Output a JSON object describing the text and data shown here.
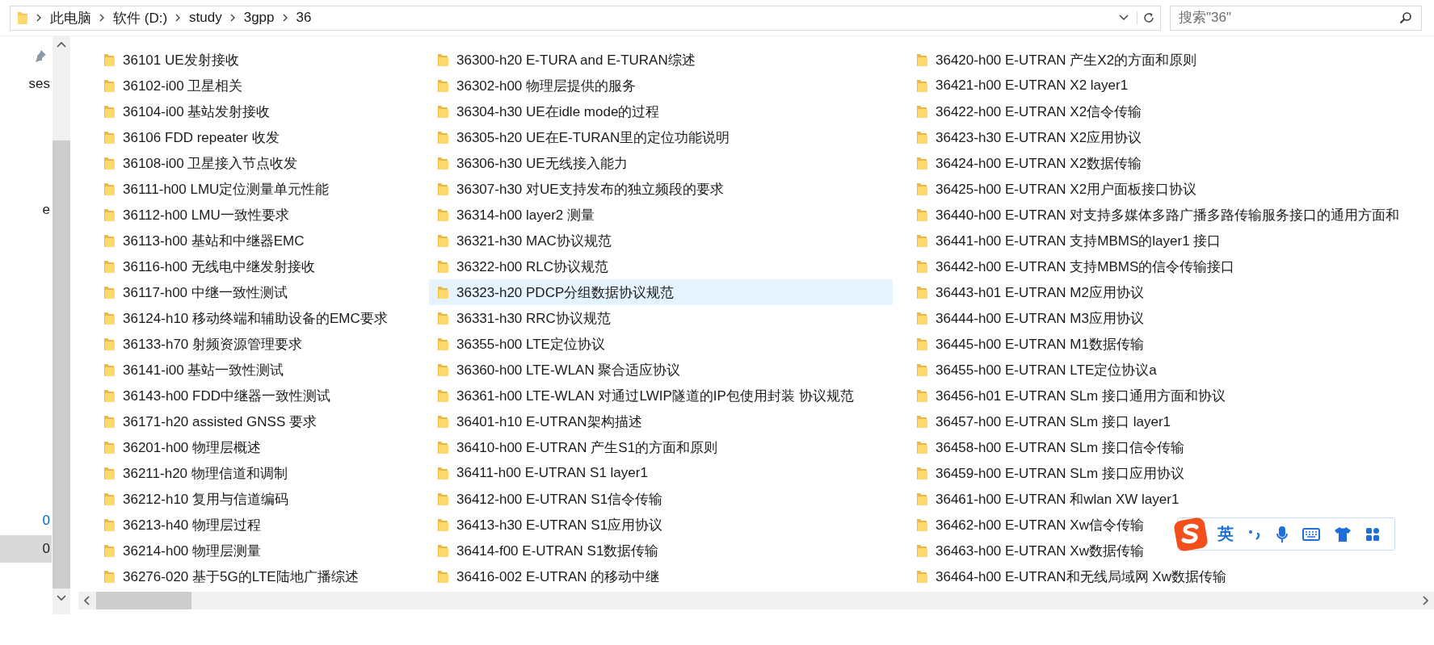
{
  "address_bar": {
    "path": [
      "此电脑",
      "软件 (D:)",
      "study",
      "3gpp",
      "36"
    ]
  },
  "search": {
    "placeholder": "搜索\"36\""
  },
  "nav_pane": {
    "items": [
      {
        "label": "ses",
        "selected": false,
        "kind": "plain"
      },
      {
        "label": "e",
        "selected": false,
        "kind": "plain"
      },
      {
        "label": "0",
        "selected": false,
        "kind": "link"
      },
      {
        "label": "0",
        "selected": true,
        "kind": "plain"
      }
    ]
  },
  "files": {
    "items": [
      {
        "name": "36101 UE发射接收",
        "selected": false
      },
      {
        "name": "36102-i00 卫星相关",
        "selected": false
      },
      {
        "name": "36104-i00 基站发射接收",
        "selected": false
      },
      {
        "name": "36106 FDD repeater 收发",
        "selected": false
      },
      {
        "name": "36108-i00 卫星接入节点收发",
        "selected": false
      },
      {
        "name": "36111-h00 LMU定位测量单元性能",
        "selected": false
      },
      {
        "name": "36112-h00 LMU一致性要求",
        "selected": false
      },
      {
        "name": "36113-h00 基站和中继器EMC",
        "selected": false
      },
      {
        "name": "36116-h00 无线电中继发射接收",
        "selected": false
      },
      {
        "name": "36117-h00 中继一致性测试",
        "selected": false
      },
      {
        "name": "36124-h10 移动终端和辅助设备的EMC要求",
        "selected": false
      },
      {
        "name": "36133-h70 射频资源管理要求",
        "selected": false
      },
      {
        "name": "36141-i00 基站一致性测试",
        "selected": false
      },
      {
        "name": "36143-h00 FDD中继器一致性测试",
        "selected": false
      },
      {
        "name": "36171-h20 assisted GNSS 要求",
        "selected": false
      },
      {
        "name": "36201-h00 物理层概述",
        "selected": false
      },
      {
        "name": "36211-h20 物理信道和调制",
        "selected": false
      },
      {
        "name": "36212-h10 复用与信道编码",
        "selected": false
      },
      {
        "name": "36213-h40 物理层过程",
        "selected": false
      },
      {
        "name": "36214-h00 物理层测量",
        "selected": false
      },
      {
        "name": "36276-020 基于5G的LTE陆地广播综述",
        "selected": false
      },
      {
        "name": "36300-h20 E-TURA and E-TURAN综述",
        "selected": false
      },
      {
        "name": "36302-h00 物理层提供的服务",
        "selected": false
      },
      {
        "name": "36304-h30 UE在idle mode的过程",
        "selected": false
      },
      {
        "name": "36305-h20 UE在E-TURAN里的定位功能说明",
        "selected": false
      },
      {
        "name": "36306-h30 UE无线接入能力",
        "selected": false
      },
      {
        "name": "36307-h30 对UE支持发布的独立频段的要求",
        "selected": false
      },
      {
        "name": "36314-h00 layer2 测量",
        "selected": false
      },
      {
        "name": "36321-h30 MAC协议规范",
        "selected": false
      },
      {
        "name": "36322-h00 RLC协议规范",
        "selected": false
      },
      {
        "name": "36323-h20 PDCP分组数据协议规范",
        "selected": true
      },
      {
        "name": "36331-h30 RRC协议规范",
        "selected": false
      },
      {
        "name": "36355-h00 LTE定位协议",
        "selected": false
      },
      {
        "name": "36360-h00 LTE-WLAN 聚合适应协议",
        "selected": false
      },
      {
        "name": "36361-h00 LTE-WLAN 对通过LWIP隧道的IP包使用封装 协议规范",
        "selected": false
      },
      {
        "name": "36401-h10 E-UTRAN架构描述",
        "selected": false
      },
      {
        "name": "36410-h00 E-UTRAN 产生S1的方面和原则",
        "selected": false
      },
      {
        "name": "36411-h00 E-UTRAN S1 layer1",
        "selected": false
      },
      {
        "name": "36412-h00 E-UTRAN S1信令传输",
        "selected": false
      },
      {
        "name": "36413-h30 E-UTRAN S1应用协议",
        "selected": false
      },
      {
        "name": "36414-f00 E-UTRAN S1数据传输",
        "selected": false
      },
      {
        "name": "36416-002 E-UTRAN 的移动中继",
        "selected": false
      },
      {
        "name": "36420-h00 E-UTRAN 产生X2的方面和原则",
        "selected": false
      },
      {
        "name": "36421-h00 E-UTRAN X2 layer1",
        "selected": false
      },
      {
        "name": "36422-h00 E-UTRAN X2信令传输",
        "selected": false
      },
      {
        "name": "36423-h30 E-UTRAN X2应用协议",
        "selected": false
      },
      {
        "name": "36424-h00 E-UTRAN X2数据传输",
        "selected": false
      },
      {
        "name": "36425-h00 E-UTRAN X2用户面板接口协议",
        "selected": false
      },
      {
        "name": "36440-h00 E-UTRAN 对支持多媒体多路广播多路传输服务接口的通用方面和",
        "selected": false
      },
      {
        "name": "36441-h00 E-UTRAN 支持MBMS的layer1 接口",
        "selected": false
      },
      {
        "name": "36442-h00 E-UTRAN 支持MBMS的信令传输接口",
        "selected": false
      },
      {
        "name": "36443-h01 E-UTRAN M2应用协议",
        "selected": false
      },
      {
        "name": "36444-h00 E-UTRAN M3应用协议",
        "selected": false
      },
      {
        "name": "36445-h00 E-UTRAN M1数据传输",
        "selected": false
      },
      {
        "name": "36455-h00 E-UTRAN LTE定位协议a",
        "selected": false
      },
      {
        "name": "36456-h01 E-UTRAN SLm 接口通用方面和协议",
        "selected": false
      },
      {
        "name": "36457-h00 E-UTRAN SLm 接口 layer1",
        "selected": false
      },
      {
        "name": "36458-h00 E-UTRAN SLm 接口信令传输",
        "selected": false
      },
      {
        "name": "36459-h00 E-UTRAN SLm 接口应用协议",
        "selected": false
      },
      {
        "name": "36461-h00 E-UTRAN 和wlan XW layer1",
        "selected": false
      },
      {
        "name": "36462-h00 E-UTRAN Xw信令传输",
        "selected": false
      },
      {
        "name": "36463-h00 E-UTRAN Xw数据传输",
        "selected": false
      },
      {
        "name": "36464-h00 E-UTRAN和无线局域网 Xw数据传输",
        "selected": false
      }
    ]
  },
  "ime_toolbar": {
    "mode": "英"
  }
}
